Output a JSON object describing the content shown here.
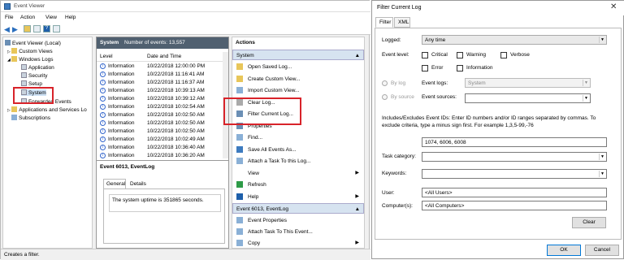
{
  "window": {
    "title": "Event Viewer",
    "menu": [
      "File",
      "Action",
      "View",
      "Help"
    ],
    "status": "Creates a filter."
  },
  "tree": {
    "items": [
      "Event Viewer (Local)",
      "Custom Views",
      "Windows Logs",
      "Application",
      "Security",
      "Setup",
      "System",
      "Forwarded Events",
      "Applications and Services Lo",
      "Subscriptions"
    ]
  },
  "list": {
    "title": "System",
    "count": "Number of events: 13,557",
    "columns": [
      "Level",
      "Date and Time"
    ],
    "rows": [
      {
        "level": "Information",
        "date": "10/22/2018 12:00:00 PM"
      },
      {
        "level": "Information",
        "date": "10/22/2018 11:16:41 AM"
      },
      {
        "level": "Information",
        "date": "10/22/2018 11:16:37 AM"
      },
      {
        "level": "Information",
        "date": "10/22/2018 10:39:13 AM"
      },
      {
        "level": "Information",
        "date": "10/22/2018 10:39:12 AM"
      },
      {
        "level": "Information",
        "date": "10/22/2018 10:02:54 AM"
      },
      {
        "level": "Information",
        "date": "10/22/2018 10:02:50 AM"
      },
      {
        "level": "Information",
        "date": "10/22/2018 10:02:50 AM"
      },
      {
        "level": "Information",
        "date": "10/22/2018 10:02:50 AM"
      },
      {
        "level": "Information",
        "date": "10/22/2018 10:02:49 AM"
      },
      {
        "level": "Information",
        "date": "10/22/2018 10:36:40 AM"
      },
      {
        "level": "Information",
        "date": "10/22/2018 10:36:20 AM"
      }
    ],
    "detail_title": "Event 6013, EventLog",
    "detail_tabs": [
      "General",
      "Details"
    ],
    "detail_text": "The system uptime is 351865 seconds."
  },
  "actions": {
    "header": "Actions",
    "section1": "System",
    "items1": [
      "Open Saved Log...",
      "Create Custom View...",
      "Import Custom View...",
      "Clear Log...",
      "Filter Current Log...",
      "Properties",
      "Find...",
      "Save All Events As...",
      "Attach a Task To this Log...",
      "View",
      "Refresh",
      "Help"
    ],
    "section2": "Event 6013, EventLog",
    "items2": [
      "Event Properties",
      "Attach Task To This Event...",
      "Copy"
    ]
  },
  "dialog": {
    "title": "Filter Current Log",
    "tabs": [
      "Filter",
      "XML"
    ],
    "logged_label": "Logged:",
    "logged_value": "Any time",
    "level_label": "Event level:",
    "levels": [
      "Critical",
      "Warning",
      "Verbose",
      "Error",
      "Information"
    ],
    "bylog_label": "By log",
    "bysource_label": "By source",
    "eventlogs_label": "Event logs:",
    "eventlogs_value": "System",
    "sources_label": "Event sources:",
    "help_text_1": "Includes/Excludes Event IDs: Enter ID numbers and/or ID ranges separated by commas. To",
    "help_text_2": "exclude criteria, type a minus sign first. For example 1,3,5-99,-76",
    "ids_value": "1074, 6006, 6008",
    "task_label": "Task category:",
    "keywords_label": "Keywords:",
    "user_label": "User:",
    "user_value": "<All Users>",
    "computer_label": "Computer(s):",
    "computer_value": "<All Computers>",
    "clear_label": "Clear",
    "ok_label": "OK",
    "cancel_label": "Cancel"
  }
}
